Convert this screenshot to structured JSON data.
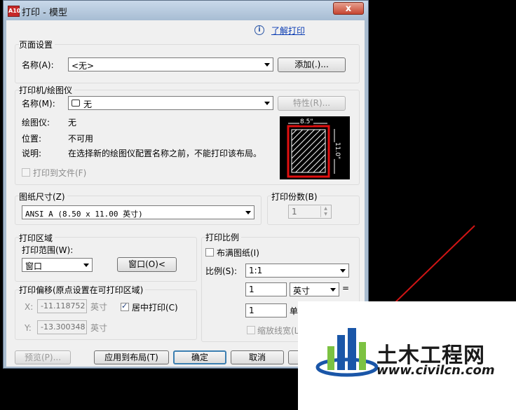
{
  "window": {
    "title": "打印 - 模型",
    "app_icon_text": "A10",
    "close_symbol": "x"
  },
  "help": {
    "icon_symbol": "i",
    "link": "了解打印"
  },
  "page_setup": {
    "title": "页面设置",
    "name_label": "名称(A):",
    "name_value": "<无>",
    "add_button": "添加(.)..."
  },
  "printer": {
    "title": "打印机/绘图仪",
    "name_label": "名称(M):",
    "name_value": "无",
    "properties_button": "特性(R)...",
    "plotter_label": "绘图仪:",
    "plotter_value": "无",
    "location_label": "位置:",
    "location_value": "不可用",
    "description_label": "说明:",
    "description_value": "在选择新的绘图仪配置名称之前，不能打印该布局。",
    "print_to_file": "打印到文件(F)",
    "preview_width_label": "8.5\"",
    "preview_height_label": "11.0\""
  },
  "paper_size": {
    "title": "图纸尺寸(Z)",
    "value": "ANSI A (8.50 x 11.00 英寸)"
  },
  "copies": {
    "title": "打印份数(B)",
    "value": "1"
  },
  "plot_area": {
    "title": "打印区域",
    "range_label": "打印范围(W):",
    "range_value": "窗口",
    "window_button": "窗口(O)<"
  },
  "plot_offset": {
    "title": "打印偏移(原点设置在可打印区域)",
    "x_label": "X:",
    "x_value": "-11.118752",
    "x_unit": "英寸",
    "y_label": "Y:",
    "y_value": "-13.300348",
    "y_unit": "英寸",
    "center_plot": "居中打印(C)"
  },
  "plot_scale": {
    "title": "打印比例",
    "fit_to_paper": "布满图纸(I)",
    "scale_label": "比例(S):",
    "scale_value": "1:1",
    "inches_value": "1",
    "inches_unit": "英寸",
    "equals": "=",
    "units_value": "1",
    "units_label": "单位",
    "scale_lineweights": "缩放线宽(L)"
  },
  "buttons": {
    "preview": "预览(P)...",
    "apply_to_layout": "应用到布局(T)",
    "ok": "确定",
    "cancel": "取消"
  },
  "watermark": {
    "brand": "土木工程网",
    "url": "www.civilcn.com"
  },
  "colors": {
    "accent": "#3c7fb1",
    "preview_frame": "#e01010",
    "logo_blue": "#1a56a8",
    "logo_green": "#7cc242"
  }
}
